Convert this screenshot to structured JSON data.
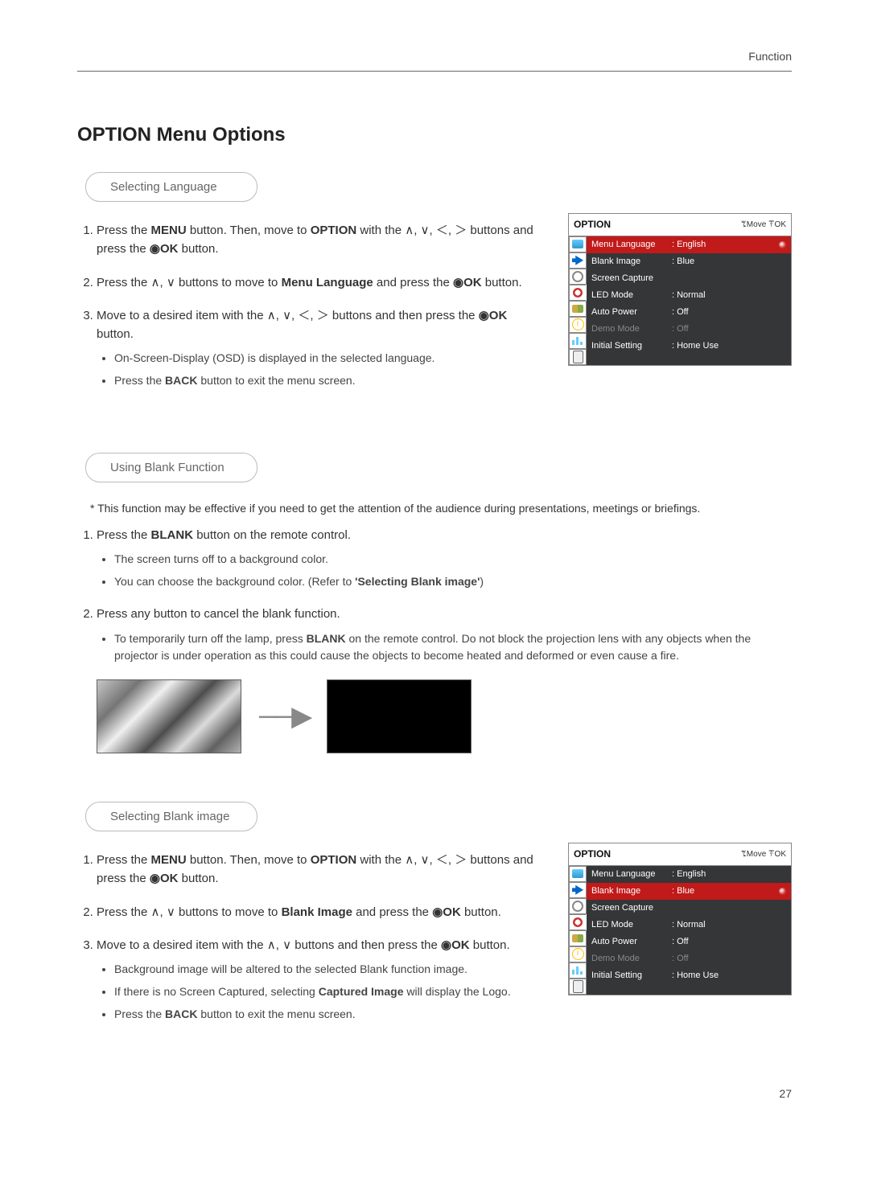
{
  "header": {
    "category": "Function"
  },
  "h1": "OPTION Menu Options",
  "page_number": "27",
  "osd_defaults": {
    "title": "OPTION",
    "hints_move": "ꔂMove",
    "hints_ok": "ꔉOK",
    "rows": [
      {
        "label": "Menu Language",
        "value": ": English"
      },
      {
        "label": "Blank Image",
        "value": ": Blue"
      },
      {
        "label": "Screen Capture",
        "value": ""
      },
      {
        "label": "LED Mode",
        "value": ": Normal"
      },
      {
        "label": "Auto Power",
        "value": ": Off"
      },
      {
        "label": "Demo Mode",
        "value": ": Off",
        "dim": true
      },
      {
        "label": "Initial Setting",
        "value": ": Home Use"
      }
    ]
  },
  "sec1": {
    "pill": "Selecting Language",
    "step1_a": "Press the ",
    "step1_b": "MENU",
    "step1_c": " button. Then, move to ",
    "step1_d": "OPTION",
    "step1_e": " with the ∧, ∨, ＜, ＞ buttons and press the ",
    "step1_f": "◉OK",
    "step1_g": " button.",
    "step2_a": "Press the ∧, ∨ buttons to move to ",
    "step2_b": "Menu Language",
    "step2_c": " and press the ",
    "step2_d": "◉OK",
    "step2_e": " button.",
    "step3_a": "Move to a desired item with the ∧, ∨, ＜, ＞ buttons and then press the ",
    "step3_b": "◉OK",
    "step3_c": " button.",
    "sub1": "On-Screen-Display (OSD) is displayed in the selected language.",
    "sub2_a": "Press the ",
    "sub2_b": "BACK",
    "sub2_c": " button to exit the menu screen.",
    "selected_index": 0
  },
  "sec2": {
    "pill": "Using Blank Function",
    "note": "* This function may be effective if you need to get the attention of the audience during presentations, meetings or briefings.",
    "step1_a": "Press the ",
    "step1_b": "BLANK",
    "step1_c": " button on the remote control.",
    "sub1a": "The screen turns off to a background color.",
    "sub1b_a": "You can choose the background color. ",
    "sub1b_b": "(Refer to ",
    "sub1b_c": "'Selecting Blank image'",
    "sub1b_d": ")",
    "step2": "Press any button to cancel the blank function.",
    "sub2_a": "To temporarily turn off the lamp, press ",
    "sub2_b": "BLANK",
    "sub2_c": " on the remote control. Do not block the projection lens with any objects when the projector is under operation as this could cause the objects to become heated and deformed or even cause a fire."
  },
  "sec3": {
    "pill": "Selecting Blank image",
    "step1_a": "Press the ",
    "step1_b": "MENU",
    "step1_c": " button. Then, move to ",
    "step1_d": "OPTION",
    "step1_e": " with the ∧, ∨, ＜, ＞ buttons and press the ",
    "step1_f": "◉OK",
    "step1_g": " button.",
    "step2_a": "Press the ∧, ∨ buttons to move to ",
    "step2_b": "Blank Image",
    "step2_c": " and press the ",
    "step2_d": "◉OK",
    "step2_e": " button.",
    "step3_a": "Move to a desired item with the ∧, ∨ buttons and then press the ",
    "step3_b": "◉OK",
    "step3_c": " button.",
    "sub1": "Background image will be altered to the selected Blank function image.",
    "sub2_a": "If there is no Screen Captured, selecting ",
    "sub2_b": "Captured Image",
    "sub2_c": " will display the Logo.",
    "sub3_a": "Press the ",
    "sub3_b": "BACK",
    "sub3_c": " button to exit the menu screen.",
    "selected_index": 1
  }
}
